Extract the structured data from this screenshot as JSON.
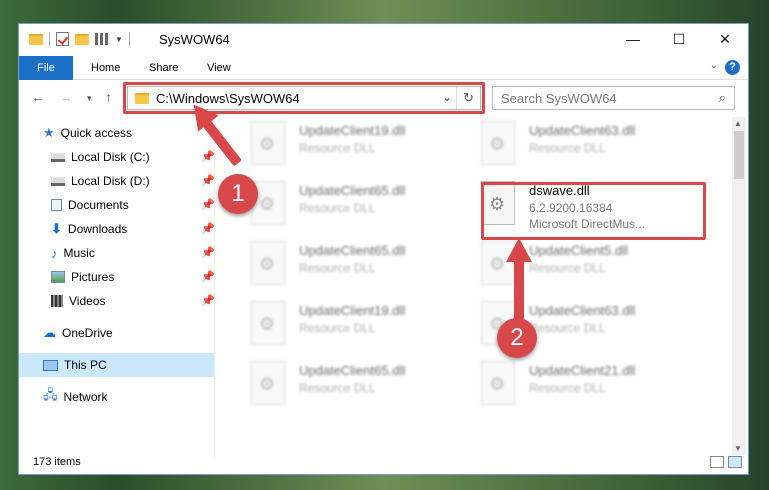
{
  "window": {
    "title": "SysWOW64"
  },
  "caption": {
    "min": "—",
    "max": "☐",
    "close": "✕"
  },
  "ribbon": {
    "tabs": [
      "File",
      "Home",
      "Share",
      "View"
    ],
    "help": "?"
  },
  "address": {
    "path": "C:\\Windows\\SysWOW64"
  },
  "search": {
    "placeholder": "Search SysWOW64"
  },
  "sidebar": {
    "items": [
      {
        "label": "Quick access"
      },
      {
        "label": "Local Disk (C:)"
      },
      {
        "label": "Local Disk (D:)"
      },
      {
        "label": "Documents"
      },
      {
        "label": "Downloads"
      },
      {
        "label": "Music"
      },
      {
        "label": "Pictures"
      },
      {
        "label": "Videos"
      },
      {
        "label": "OneDrive"
      },
      {
        "label": "This PC"
      },
      {
        "label": "Network"
      }
    ]
  },
  "files": [
    {
      "name": "UpdateClient19.dll",
      "type": "Resource DLL"
    },
    {
      "name": "UpdateClient63.dll",
      "type": "Resource DLL"
    },
    {
      "name": "UpdateClient65.dll",
      "type": "Resource DLL"
    },
    {
      "name": "dswave.dll",
      "type": "6.2.9200.16384",
      "desc": "Microsoft DirectMus..."
    },
    {
      "name": "UpdateClient65.dll",
      "type": "Resource DLL"
    },
    {
      "name": "UpdateClient5.dll",
      "type": "Resource DLL"
    },
    {
      "name": "UpdateClient19.dll",
      "type": "Resource DLL"
    },
    {
      "name": "UpdateClient63.dll",
      "type": "Resource DLL"
    },
    {
      "name": "UpdateClient65.dll",
      "type": "Resource DLL"
    },
    {
      "name": "UpdateClient21.dll",
      "type": "Resource DLL"
    }
  ],
  "status": {
    "count": "173 items"
  },
  "annotations": {
    "one": "1",
    "two": "2"
  },
  "colors": {
    "accent": "#1a6fc6",
    "highlight": "#d8474a"
  }
}
